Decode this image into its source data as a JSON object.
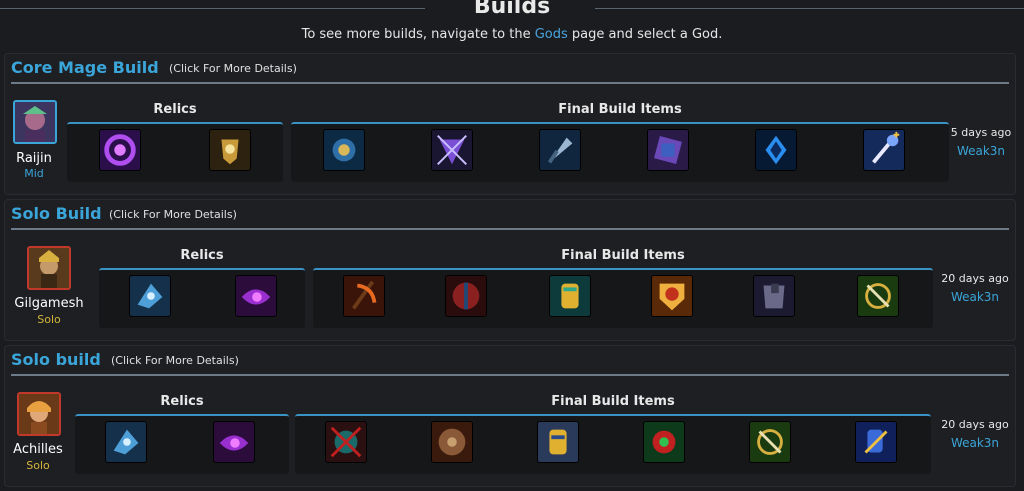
{
  "header": {
    "title": "Builds",
    "subtitle_pre": "To see more builds, navigate to the ",
    "subtitle_link": "Gods",
    "subtitle_post": " page and select a God."
  },
  "builds": [
    {
      "title": "Core Mage Build",
      "hint": "(Click For More Details)",
      "god": "Raijin",
      "role": "Mid",
      "relics_label": "Relics",
      "items_label": "Final Build Items",
      "date": "5 days ago",
      "author": "Weak3n",
      "relics": [
        "purge-beads-icon",
        "aegis-amulet-icon"
      ],
      "items": [
        "book-of-thoth-icon",
        "soul-gem-icon",
        "spear-of-desolation-icon",
        "obsidian-shard-icon",
        "divine-ruin-icon",
        "staff-of-myrddin-icon"
      ]
    },
    {
      "title": "Solo Build",
      "hint": "(Click For More Details)",
      "god": "Gilgamesh",
      "role": "Solo",
      "relics_label": "Relics",
      "items_label": "Final Build Items",
      "date": "20 days ago",
      "author": "Weak3n",
      "relics": [
        "blink-rune-icon",
        "purification-beads-icon"
      ],
      "items": [
        "scythe-icon",
        "shield-icon",
        "gauntlet-icon",
        "ancile-icon",
        "breastplate-icon",
        "sword-buckler-icon"
      ]
    },
    {
      "title": "Solo build",
      "hint": "(Click For More Details)",
      "god": "Achilles",
      "role": "Solo",
      "relics_label": "Relics",
      "items_label": "Final Build Items",
      "date": "20 days ago",
      "author": "Weak3n",
      "relics": [
        "blink-rune-icon",
        "purification-beads-icon"
      ],
      "items": [
        "axe-shield-icon",
        "round-shield-icon",
        "gauntlet-icon",
        "pestilence-icon",
        "sword-buckler-icon",
        "blue-gauntlet-icon"
      ]
    }
  ],
  "colors": {
    "accent": "#3aa5d8",
    "mid": "#3aa5d8",
    "solo": "#d4b63a"
  }
}
